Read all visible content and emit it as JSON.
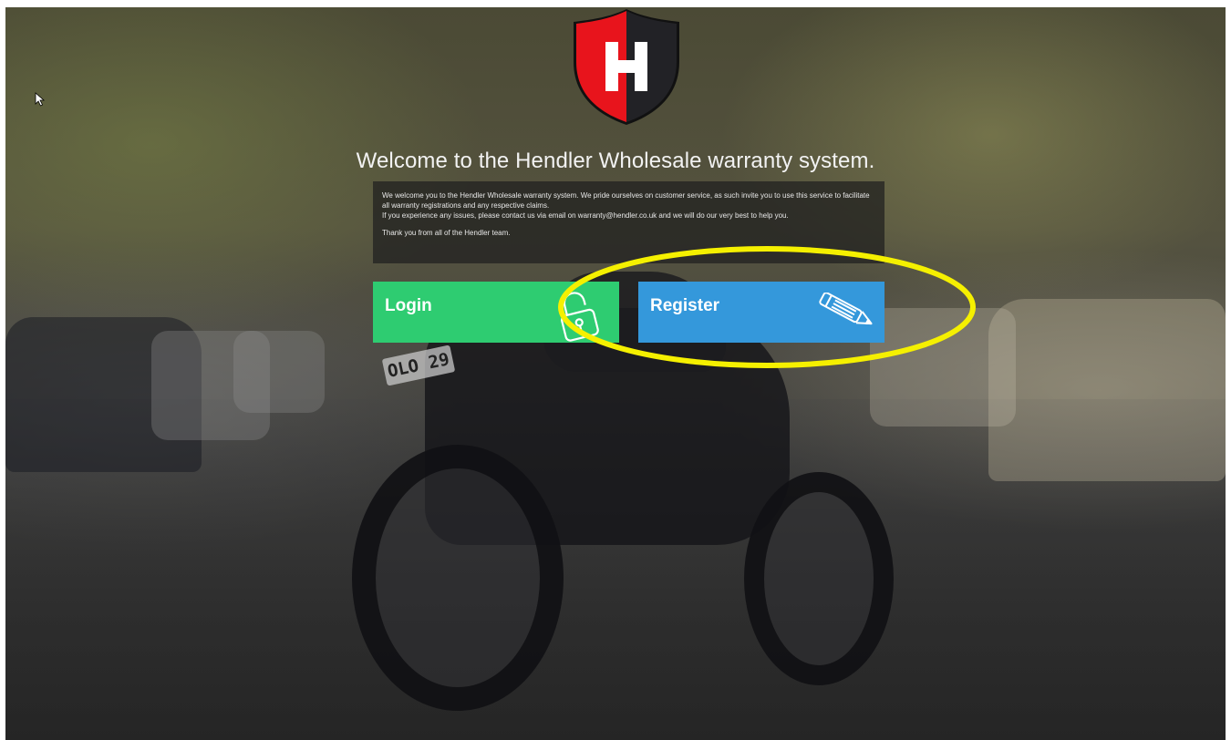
{
  "logo": {
    "letter": "H"
  },
  "welcome": {
    "title": "Welcome to the Hendler Wholesale warranty system.",
    "paragraph1": "We welcome you to the Hendler Wholesale warranty system. We pride ourselves on customer service, as such invite you to use this service to facilitate all warranty registrations and any respective claims.",
    "paragraph2": "If you experience any issues, please contact us via email on warranty@hendler.co.uk and we will do our very best to help you.",
    "paragraph3": "Thank you from all of the Hendler team."
  },
  "buttons": {
    "login_label": "Login",
    "register_label": "Register"
  },
  "icons": {
    "login": "padlock-icon",
    "register": "pencil-icon"
  },
  "background": {
    "plate_text": "OLO 29"
  },
  "colors": {
    "login_button": "#2ecc71",
    "register_button": "#3498db",
    "logo_red": "#e8141c",
    "annotation_highlight": "#f5f000"
  }
}
